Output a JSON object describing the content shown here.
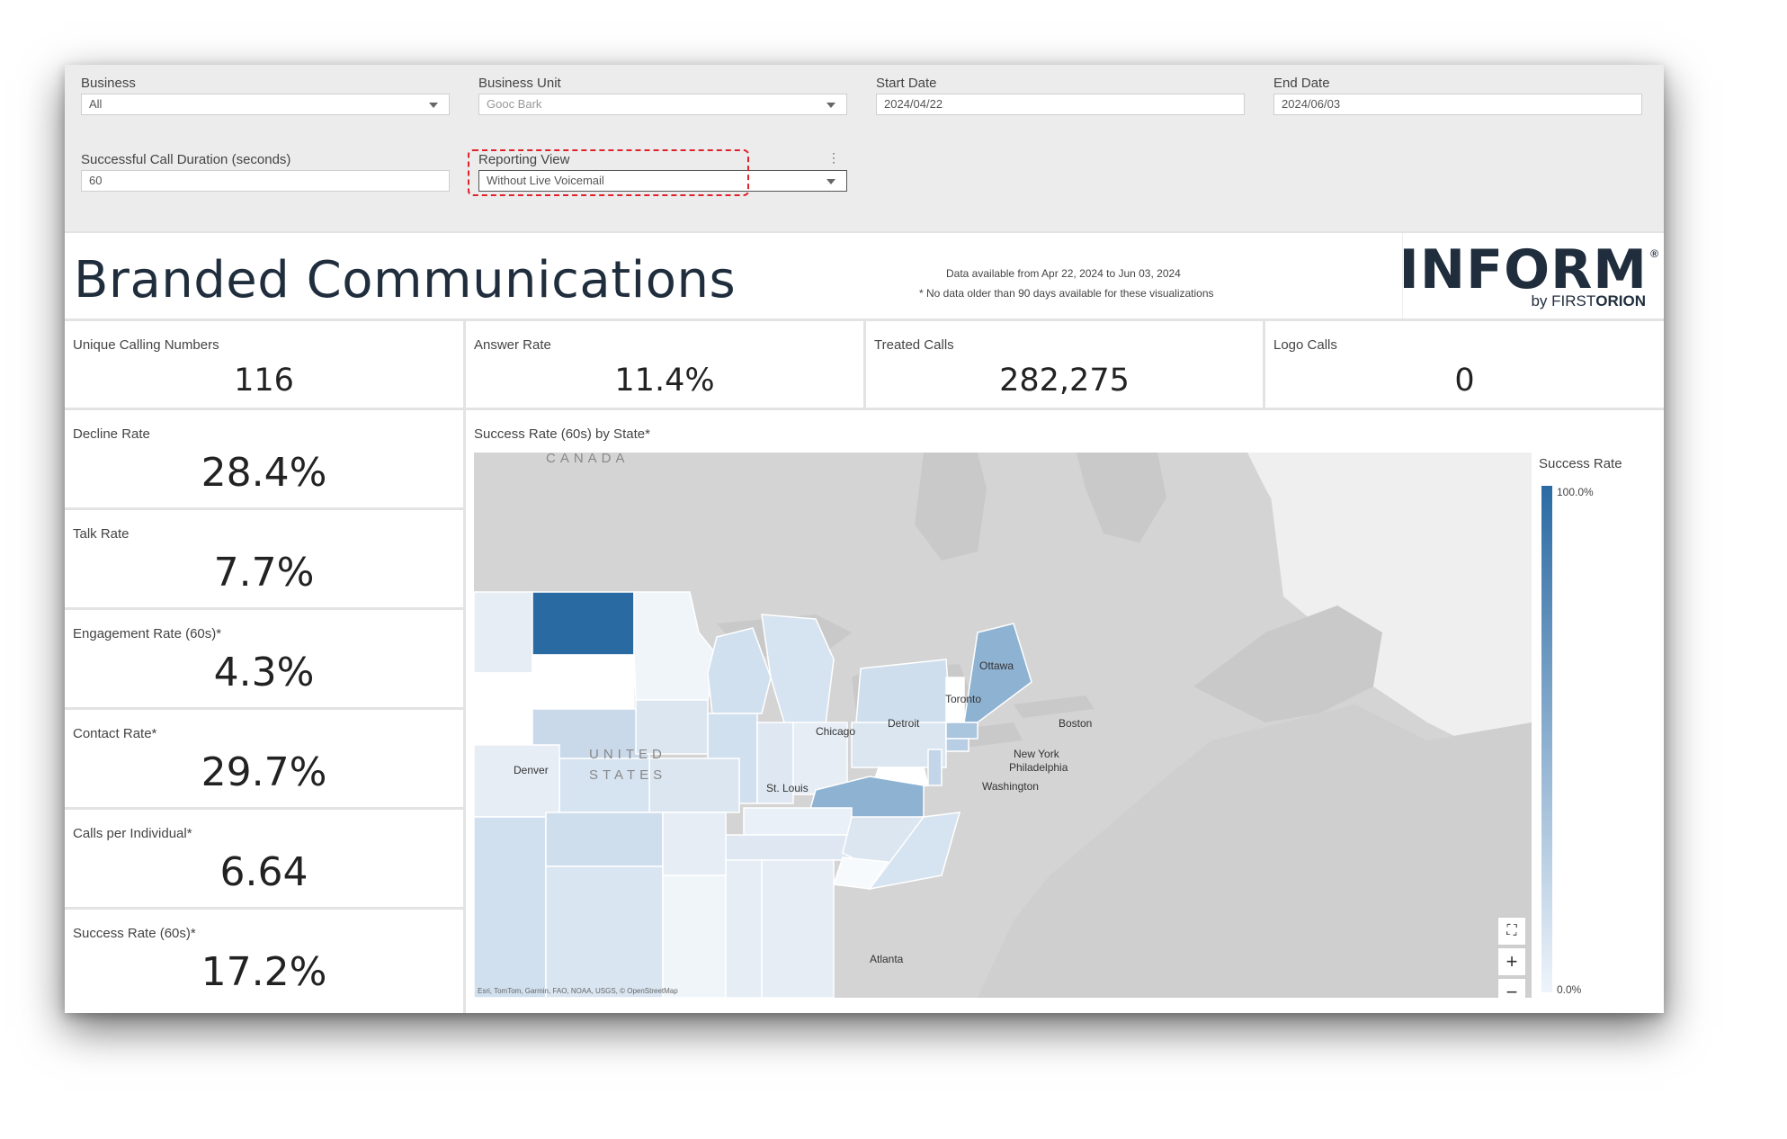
{
  "filters": {
    "business": {
      "label": "Business",
      "value": "All"
    },
    "business_unit": {
      "label": "Business Unit",
      "value": "Gooc Bark"
    },
    "start_date": {
      "label": "Start Date",
      "value": "2024/04/22"
    },
    "end_date": {
      "label": "End Date",
      "value": "2024/06/03"
    },
    "call_duration": {
      "label": "Successful Call Duration (seconds)",
      "value": "60"
    },
    "reporting_view": {
      "label": "Reporting View",
      "value": "Without Live Voicemail"
    }
  },
  "header": {
    "title": "Branded Communications",
    "data_note": "Data available from Apr 22, 2024 to Jun 03, 2024",
    "data_note2": "* No data older than 90 days available for these visualizations",
    "logo_word": "INFORM",
    "logo_reg": "®",
    "logo_by": "by ",
    "logo_brand_first": "FIRST",
    "logo_brand_second": "ORION"
  },
  "kpis_top": [
    {
      "label": "Unique Calling Numbers",
      "value": "116"
    },
    {
      "label": "Answer Rate",
      "value": "11.4%"
    },
    {
      "label": "Treated Calls",
      "value": "282,275"
    },
    {
      "label": "Logo Calls",
      "value": "0"
    }
  ],
  "kpis_side": [
    {
      "label": "Decline Rate",
      "value": "28.4%"
    },
    {
      "label": "Talk Rate",
      "value": "7.7%"
    },
    {
      "label": "Engagement Rate (60s)*",
      "value": "4.3%"
    },
    {
      "label": "Contact Rate*",
      "value": "29.7%"
    },
    {
      "label": "Calls per Individual*",
      "value": "6.64"
    },
    {
      "label": "Success Rate (60s)*",
      "value": "17.2%"
    }
  ],
  "map": {
    "title": "Success Rate (60s) by State*",
    "region_labels": {
      "canada": "CANADA",
      "united": "UNITED",
      "states": "STATES"
    },
    "cities": [
      "Ottawa",
      "Toronto",
      "Detroit",
      "Chicago",
      "Boston",
      "New York",
      "Philadelphia",
      "Washington",
      "Denver",
      "St. Louis",
      "Atlanta"
    ],
    "attribution": "Esri, TomTom, Garmin, FAO, NOAA, USGS, © OpenStreetMap",
    "legend_title": "Success Rate",
    "legend_max": "100.0%",
    "legend_min": "0.0%",
    "zoom_fit_icon": "fit-extent-icon",
    "zoom_in": "+",
    "zoom_out": "−",
    "color_high": "#2a6aa3",
    "color_low": "#eef4fb"
  }
}
